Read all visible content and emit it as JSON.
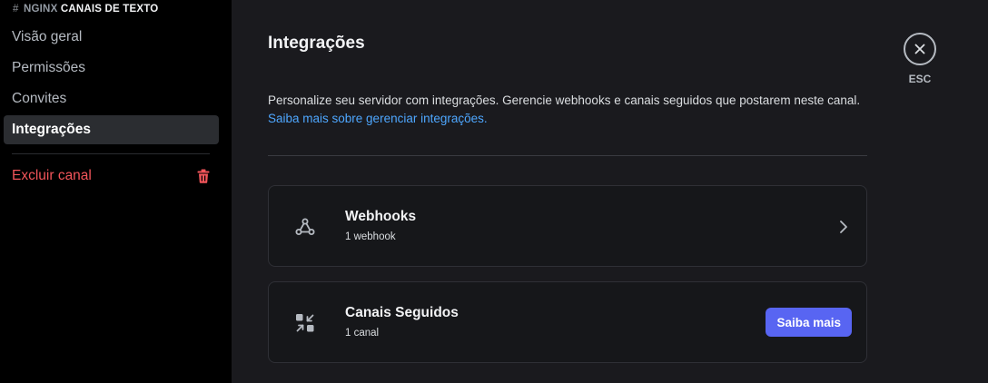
{
  "sidebar": {
    "header": {
      "hash": "#",
      "server": "NGINX",
      "category": "CANAIS DE TEXTO"
    },
    "items": [
      {
        "label": "Visão geral"
      },
      {
        "label": "Permissões"
      },
      {
        "label": "Convites"
      },
      {
        "label": "Integrações"
      }
    ],
    "delete_label": "Excluir canal"
  },
  "main": {
    "title": "Integrações",
    "description": "Personalize seu servidor com integrações. Gerencie webhooks e canais seguidos que postarem neste canal.",
    "learn_link": "Saiba mais sobre gerenciar integrações.",
    "cards": [
      {
        "title": "Webhooks",
        "subtitle": "1 webhook",
        "icon": "webhook-icon"
      },
      {
        "title": "Canais Seguidos",
        "subtitle": "1 canal",
        "icon": "followed-channels-icon",
        "button": "Saiba mais"
      }
    ],
    "close_label": "ESC"
  },
  "colors": {
    "accent": "#5865f2",
    "danger": "#f2555a",
    "link": "#4ea7ff"
  }
}
